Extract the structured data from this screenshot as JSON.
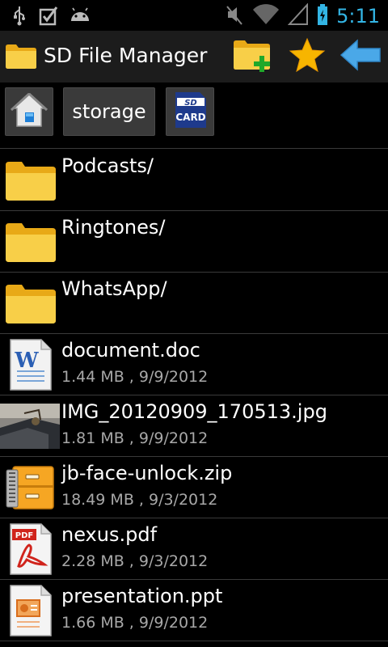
{
  "status_bar": {
    "time": "5:11",
    "icons": [
      "usb-icon",
      "checkbox-icon",
      "android-icon",
      "mute-icon",
      "wifi-icon",
      "signal-icon",
      "battery-icon"
    ]
  },
  "action_bar": {
    "title": "SD File Manager",
    "app_icon": "folder-icon",
    "buttons": [
      "new-folder-icon",
      "star-icon",
      "back-arrow-icon"
    ]
  },
  "path_bar": {
    "home_icon": "home-icon",
    "storage_label": "storage",
    "sdcard_label": "CARD",
    "sdcard_top": "SD"
  },
  "files": [
    {
      "name": "Podcasts/",
      "meta": "",
      "icon": "folder-icon"
    },
    {
      "name": "Ringtones/",
      "meta": "",
      "icon": "folder-icon"
    },
    {
      "name": "WhatsApp/",
      "meta": "",
      "icon": "folder-icon"
    },
    {
      "name": "document.doc",
      "meta": "1.44 MB , 9/9/2012",
      "icon": "word-document-icon"
    },
    {
      "name": "IMG_20120909_170513.jpg",
      "meta": "1.81 MB , 9/9/2012",
      "icon": "image-thumbnail"
    },
    {
      "name": "jb-face-unlock.zip",
      "meta": "18.49 MB , 9/3/2012",
      "icon": "zip-archive-icon"
    },
    {
      "name": "nexus.pdf",
      "meta": "2.28 MB , 9/3/2012",
      "icon": "pdf-icon"
    },
    {
      "name": "presentation.ppt",
      "meta": "1.66 MB , 9/9/2012",
      "icon": "powerpoint-icon"
    }
  ],
  "colors": {
    "accent": "#33b5e5",
    "folder": "#f5c542",
    "actionbar_bg": "#1c1c1c",
    "divider": "#3a3a3a"
  }
}
